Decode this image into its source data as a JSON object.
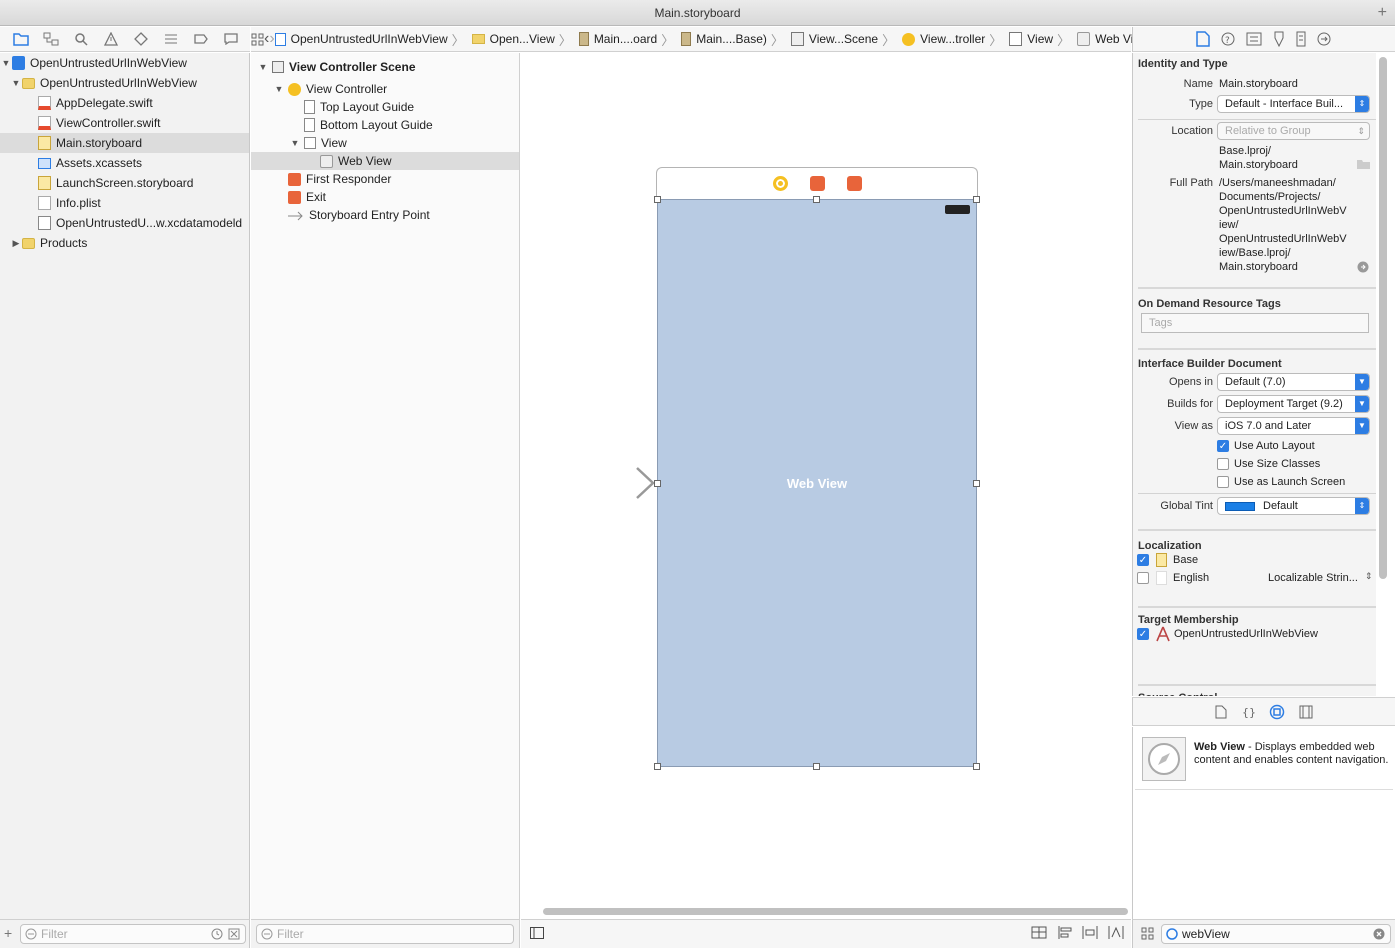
{
  "window": {
    "title": "Main.storyboard"
  },
  "navigator": {
    "items": [
      {
        "label": "OpenUntrustedUrlInWebView",
        "icon": "project-icon",
        "indent": 0,
        "expanded": true
      },
      {
        "label": "OpenUntrustedUrlInWebView",
        "icon": "folder-icon",
        "indent": 1,
        "expanded": true
      },
      {
        "label": "AppDelegate.swift",
        "icon": "swift-file-icon",
        "indent": 2
      },
      {
        "label": "ViewController.swift",
        "icon": "swift-file-icon",
        "indent": 2
      },
      {
        "label": "Main.storyboard",
        "icon": "storyboard-file-icon",
        "indent": 2,
        "selected": true
      },
      {
        "label": "Assets.xcassets",
        "icon": "assets-icon",
        "indent": 2
      },
      {
        "label": "LaunchScreen.storyboard",
        "icon": "storyboard-file-icon",
        "indent": 2
      },
      {
        "label": "Info.plist",
        "icon": "plist-file-icon",
        "indent": 2
      },
      {
        "label": "OpenUntrustedU...w.xcdatamodeld",
        "icon": "datamodel-icon",
        "indent": 2
      },
      {
        "label": "Products",
        "icon": "folder-icon",
        "indent": 0,
        "expanded": false
      }
    ],
    "filter_placeholder": "Filter"
  },
  "breadcrumbs": [
    "OpenUntrustedUrlInWebView",
    "Open...View",
    "Main....oard",
    "Main....Base)",
    "View...Scene",
    "View...troller",
    "View",
    "Web View"
  ],
  "outline": {
    "items": [
      {
        "label": "View Controller Scene",
        "bold": true
      },
      {
        "label": "View Controller"
      },
      {
        "label": "Top Layout Guide"
      },
      {
        "label": "Bottom Layout Guide"
      },
      {
        "label": "View"
      },
      {
        "label": "Web View",
        "selected": true
      },
      {
        "label": "First Responder"
      },
      {
        "label": "Exit"
      },
      {
        "label": "Storyboard Entry Point"
      }
    ],
    "filter_placeholder": "Filter"
  },
  "canvas": {
    "web_view_label": "Web View"
  },
  "inspector": {
    "identity": {
      "title": "Identity and Type",
      "name_label": "Name",
      "name_value": "Main.storyboard",
      "type_label": "Type",
      "type_value": "Default - Interface Buil...",
      "location_label": "Location",
      "location_value": "Relative to Group",
      "location_path_1": "Base.lproj/",
      "location_path_2": "Main.storyboard",
      "fullpath_label": "Full Path",
      "fullpath_1": "/Users/maneeshmadan/",
      "fullpath_2": "Documents/Projects/",
      "fullpath_3": "OpenUntrustedUrlInWebV",
      "fullpath_4": "iew/",
      "fullpath_5": "OpenUntrustedUrlInWebV",
      "fullpath_6": "iew/Base.lproj/",
      "fullpath_7": "Main.storyboard"
    },
    "resource_tags": {
      "title": "On Demand Resource Tags",
      "placeholder": "Tags"
    },
    "ib_document": {
      "title": "Interface Builder Document",
      "opens_in_label": "Opens in",
      "opens_in_value": "Default (7.0)",
      "builds_for_label": "Builds for",
      "builds_for_value": "Deployment Target (9.2)",
      "view_as_label": "View as",
      "view_as_value": "iOS 7.0 and Later",
      "auto_layout": "Use Auto Layout",
      "size_classes": "Use Size Classes",
      "launch_screen": "Use as Launch Screen",
      "global_tint_label": "Global Tint",
      "global_tint_value": "Default",
      "tint_color": "#1a7fe6"
    },
    "localization": {
      "title": "Localization",
      "base": "Base",
      "english": "English",
      "english_type": "Localizable Strin..."
    },
    "target_membership": {
      "title": "Target Membership",
      "target": "OpenUntrustedUrlInWebView"
    },
    "source_control": {
      "title": "Source Control"
    }
  },
  "library": {
    "item_title": "Web View",
    "item_desc": " - Displays embedded web content and enables content navigation.",
    "search_value": "webView"
  },
  "colors": {
    "accent": "#2d7de3",
    "canvas_view": "#b8cbe3"
  }
}
